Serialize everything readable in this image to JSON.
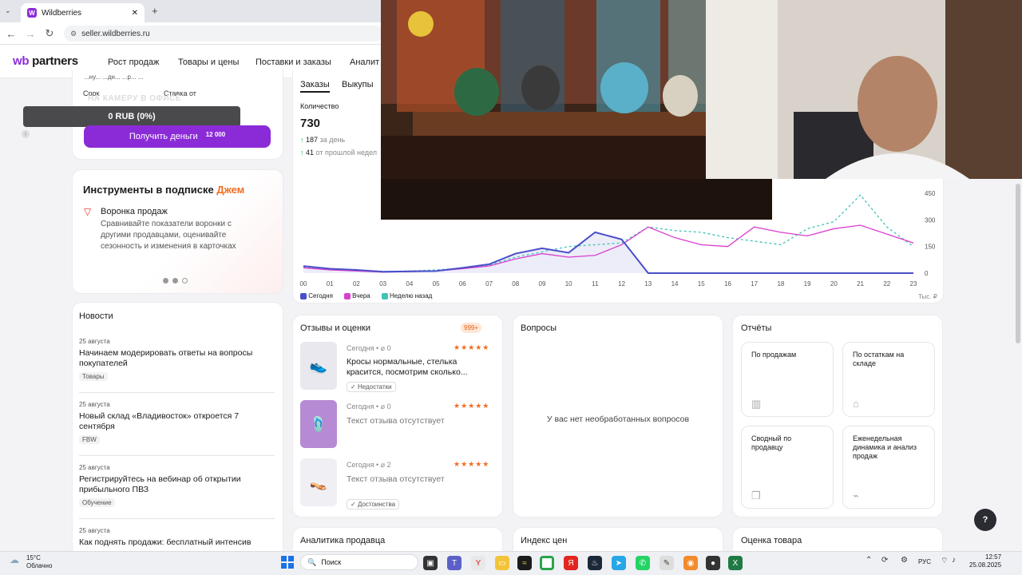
{
  "browser": {
    "tab_title": "Wildberries",
    "favicon_letter": "W",
    "url": "seller.wildberries.ru"
  },
  "header": {
    "logo_wb": "wb",
    "logo_partners": "partners",
    "nav": [
      "Рост продаж",
      "Товары и цены",
      "Поставки и заказы",
      "Аналит"
    ]
  },
  "loan": {
    "cut_text": "...ну... ...дн... ...р... ...",
    "term_label": "Срок",
    "rate_label": "Ставка от",
    "overlay_text": "НА КАМЕРУ В ОФИСЕ",
    "balance": "0 RUB (0%)",
    "button_label": "Получить деньги",
    "button_badge": "12 000"
  },
  "tools": {
    "title_main": "Инструменты в подписке",
    "title_accent": "Джем",
    "item_title": "Воронка продаж",
    "item_desc": "Сравнивайте показатели воронки с другими продавцами, оценивайте сезонность и изменения в карточках"
  },
  "orders": {
    "tabs": [
      "Заказы",
      "Выкупы"
    ],
    "qty_label": "Количество",
    "qty_value": "730",
    "per_day": "187",
    "per_day_label": "за день",
    "last_week": "41",
    "last_week_label": "от прошлой недел"
  },
  "chart_data": {
    "type": "line",
    "x": [
      "00",
      "01",
      "02",
      "03",
      "04",
      "05",
      "06",
      "07",
      "08",
      "09",
      "10",
      "11",
      "12",
      "13",
      "14",
      "15",
      "16",
      "17",
      "18",
      "19",
      "20",
      "21",
      "22",
      "23"
    ],
    "series": [
      {
        "name": "Сегодня",
        "color": "#4a4fc9",
        "values": [
          40,
          25,
          18,
          8,
          10,
          12,
          30,
          50,
          110,
          140,
          115,
          230,
          190,
          0,
          0,
          0,
          0,
          0,
          0,
          0,
          0,
          0,
          0,
          0
        ]
      },
      {
        "name": "Вчера",
        "color": "#d93fcf",
        "values": [
          30,
          18,
          12,
          6,
          8,
          12,
          25,
          40,
          80,
          110,
          90,
          100,
          160,
          260,
          200,
          160,
          150,
          260,
          230,
          210,
          250,
          270,
          220,
          170
        ]
      },
      {
        "name": "Неделю назад",
        "color": "#3fc4b4",
        "values": [
          35,
          22,
          15,
          10,
          12,
          18,
          28,
          45,
          90,
          120,
          150,
          160,
          170,
          260,
          240,
          230,
          200,
          180,
          160,
          250,
          290,
          440,
          260,
          150
        ]
      }
    ],
    "y_ticks": [
      "450",
      "300",
      "150",
      "0"
    ],
    "ylim": [
      0,
      450
    ],
    "unit": "Тыс. ₽"
  },
  "news": {
    "title": "Новости",
    "items": [
      {
        "date": "25 августа",
        "title": "Начинаем модерировать ответы на вопросы покупателей",
        "tag": "Товары"
      },
      {
        "date": "25 августа",
        "title": "Новый склад «Владивосток» откроется 7 сентября",
        "tag": "FBW"
      },
      {
        "date": "25 августа",
        "title": "Регистрируйтесь на вебинар об открытии прибыльного ПВЗ",
        "tag": "Обучение"
      },
      {
        "date": "25 августа",
        "title": "Как поднять продажи: бесплатный интенсив",
        "tag": ""
      }
    ]
  },
  "reviews": {
    "title": "Отзывы и оценки",
    "badge": "999+",
    "items": [
      {
        "day": "Сегодня",
        "attachments": "0",
        "text": "Кросы нормальные, стелька красится, посмотрим сколько...",
        "tag": "Недостатки",
        "stars": "★★★★★"
      },
      {
        "day": "Сегодня",
        "attachments": "0",
        "text": "Текст отзыва отсутствует",
        "tag": "",
        "stars": "★★★★★"
      },
      {
        "day": "Сегодня",
        "attachments": "2",
        "text": "Текст отзыва отсутствует",
        "tag": "Достоинства",
        "stars": "★★★★★"
      }
    ]
  },
  "questions": {
    "title": "Вопросы",
    "empty": "У вас нет необработанных вопросов"
  },
  "reports": {
    "title": "Отчёты",
    "tiles": [
      "По продажам",
      "По остаткам на складе",
      "Сводный по продавцу",
      "Еженедельная динамика и анализ продаж"
    ]
  },
  "bottom_cards": [
    "Аналитика продавца",
    "Индекс цен",
    "Оценка товара"
  ],
  "help_label": "?",
  "taskbar": {
    "temp": "15°C",
    "weather": "Облачно",
    "search": "Поиск",
    "lang": "РУС",
    "time": "12:57",
    "date": "25.08.2025"
  }
}
